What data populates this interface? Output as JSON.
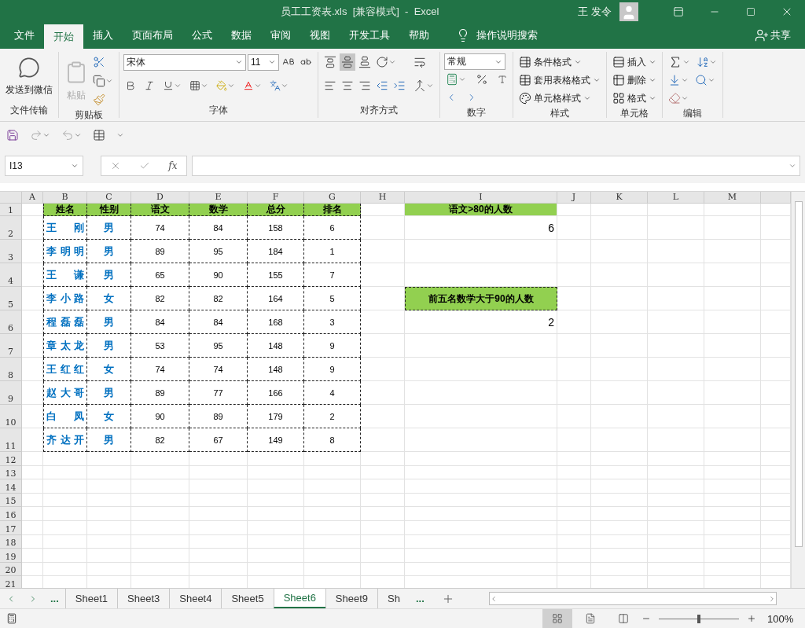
{
  "window": {
    "title": "员工工资表.xls  [兼容模式]  -  Excel",
    "user": "王 发令"
  },
  "menu_tabs": [
    {
      "label": "文件",
      "selected": false
    },
    {
      "label": "开始",
      "selected": true
    },
    {
      "label": "插入",
      "selected": false
    },
    {
      "label": "页面布局",
      "selected": false
    },
    {
      "label": "公式",
      "selected": false
    },
    {
      "label": "数据",
      "selected": false
    },
    {
      "label": "审阅",
      "selected": false
    },
    {
      "label": "视图",
      "selected": false
    },
    {
      "label": "开发工具",
      "selected": false
    },
    {
      "label": "帮助",
      "selected": false
    }
  ],
  "tell_me": "操作说明搜索",
  "share": "共享",
  "ribbon": [
    {
      "kind": "wechat",
      "title": "文件传输",
      "label": "发送到微信"
    },
    {
      "kind": "clipboard",
      "title": "剪贴板",
      "label": "粘贴"
    },
    {
      "kind": "font",
      "title": "字体",
      "font_name": "宋体",
      "font_size": "11"
    },
    {
      "kind": "alignment",
      "title": "对齐方式"
    },
    {
      "kind": "number",
      "title": "数字",
      "format": "常规"
    },
    {
      "kind": "styles",
      "title": "样式",
      "items": [
        "条件格式",
        "套用表格格式",
        "单元格样式"
      ]
    },
    {
      "kind": "cells",
      "title": "单元格",
      "items": [
        "插入",
        "删除",
        "格式"
      ]
    },
    {
      "kind": "editing",
      "title": "编辑"
    }
  ],
  "formula_bar": {
    "name_box": "I13",
    "function_label": "fx"
  },
  "sheet": {
    "columns": [
      "A",
      "B",
      "C",
      "D",
      "E",
      "F",
      "G",
      "H",
      "I",
      "J",
      "K",
      "L",
      "M"
    ],
    "row_numbers": [
      "1",
      "2",
      "3",
      "4",
      "5",
      "6",
      "7",
      "8",
      "9",
      "10",
      "11",
      "12",
      "13",
      "14",
      "15",
      "16",
      "17",
      "18",
      "19",
      "20",
      "21"
    ]
  },
  "table": {
    "columns": [
      "姓名",
      "性别",
      "语文",
      "数学",
      "总分",
      "排名"
    ],
    "rows": [
      [
        "王刚",
        "男",
        "74",
        "84",
        "158",
        "6"
      ],
      [
        "李明明",
        "男",
        "89",
        "95",
        "184",
        "1"
      ],
      [
        "王谦",
        "男",
        "65",
        "90",
        "155",
        "7"
      ],
      [
        "李小路",
        "女",
        "82",
        "82",
        "164",
        "5"
      ],
      [
        "程磊磊",
        "男",
        "84",
        "84",
        "168",
        "3"
      ],
      [
        "章太龙",
        "男",
        "53",
        "95",
        "148",
        "9"
      ],
      [
        "王红红",
        "女",
        "74",
        "74",
        "148",
        "9"
      ],
      [
        "赵大哥",
        "男",
        "89",
        "77",
        "166",
        "4"
      ],
      [
        "白凤",
        "女",
        "90",
        "89",
        "179",
        "2"
      ],
      [
        "齐达开",
        "男",
        "82",
        "67",
        "149",
        "8"
      ]
    ]
  },
  "summary": [
    {
      "label": "语文>80的人数",
      "value": "6",
      "dashed": false
    },
    {
      "label": "前五名数学大于90的人数",
      "value": "2",
      "dashed": true
    }
  ],
  "sheet_tabs": {
    "more": "...",
    "more_right": "...",
    "tabs": [
      {
        "label": "Sheet1",
        "selected": false
      },
      {
        "label": "Sheet3",
        "selected": false
      },
      {
        "label": "Sheet4",
        "selected": false
      },
      {
        "label": "Sheet5",
        "selected": false
      },
      {
        "label": "Sheet6",
        "selected": true
      },
      {
        "label": "Sheet9",
        "selected": false
      },
      {
        "label": "Sh",
        "selected": false
      }
    ]
  },
  "status_bar": {
    "zoom": "100%",
    "level": 0.5
  }
}
